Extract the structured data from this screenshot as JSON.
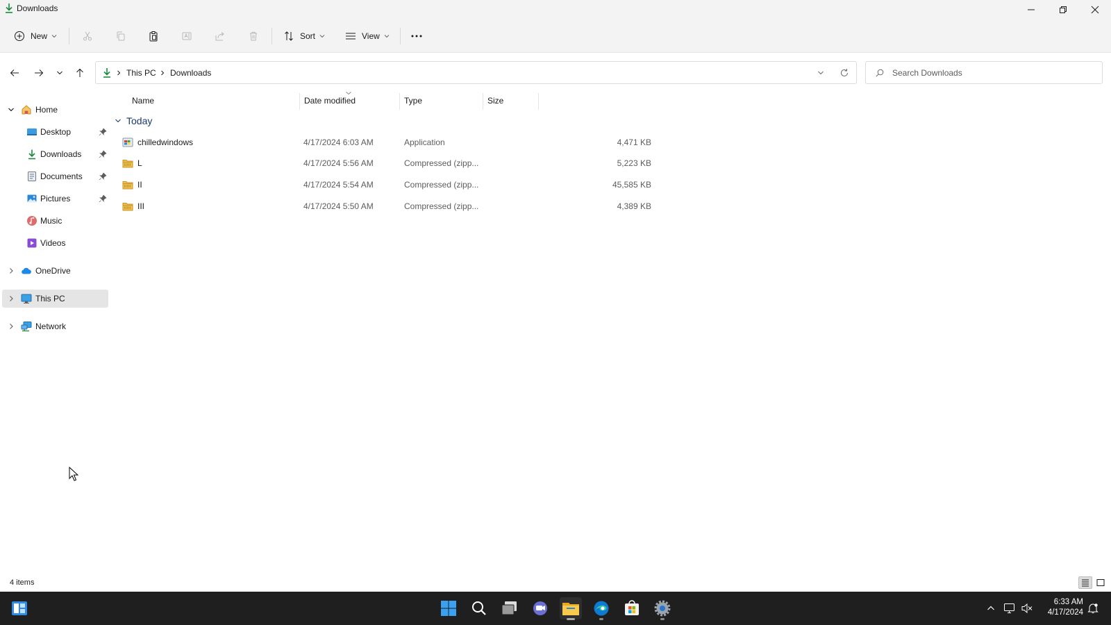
{
  "window": {
    "title": "Downloads"
  },
  "toolbar": {
    "new_label": "New",
    "sort_label": "Sort",
    "view_label": "View"
  },
  "address": {
    "crumbs": [
      "This PC",
      "Downloads"
    ]
  },
  "search": {
    "placeholder": "Search Downloads"
  },
  "sidebar": {
    "items": [
      {
        "label": "Home",
        "icon": "home-icon",
        "expanded": true
      },
      {
        "label": "Desktop",
        "icon": "desktop-icon",
        "pinned": true
      },
      {
        "label": "Downloads",
        "icon": "downloads-icon",
        "pinned": true
      },
      {
        "label": "Documents",
        "icon": "documents-icon",
        "pinned": true
      },
      {
        "label": "Pictures",
        "icon": "pictures-icon",
        "pinned": true
      },
      {
        "label": "Music",
        "icon": "music-icon"
      },
      {
        "label": "Videos",
        "icon": "videos-icon"
      },
      {
        "label": "OneDrive",
        "icon": "onedrive-icon"
      },
      {
        "label": "This PC",
        "icon": "this-pc-icon",
        "selected": true
      },
      {
        "label": "Network",
        "icon": "network-icon"
      }
    ]
  },
  "columns": {
    "name": "Name",
    "date": "Date modified",
    "type": "Type",
    "size": "Size"
  },
  "group": {
    "label": "Today"
  },
  "files": [
    {
      "name": "chilledwindows",
      "date": "4/17/2024 6:03 AM",
      "type": "Application",
      "size": "4,471 KB",
      "icon": "application-icon"
    },
    {
      "name": "L",
      "date": "4/17/2024 5:56 AM",
      "type": "Compressed (zipp...",
      "size": "5,223 KB",
      "icon": "zip-folder-icon"
    },
    {
      "name": "II",
      "date": "4/17/2024 5:54 AM",
      "type": "Compressed (zipp...",
      "size": "45,585 KB",
      "icon": "zip-folder-icon"
    },
    {
      "name": "III",
      "date": "4/17/2024 5:50 AM",
      "type": "Compressed (zipp...",
      "size": "4,389 KB",
      "icon": "zip-folder-icon"
    }
  ],
  "status": {
    "count": "4 items"
  },
  "clock": {
    "time": "6:33 AM",
    "date": "4/17/2024"
  },
  "colors": {
    "accent": "#0067c0",
    "selection": "#e5e5e5",
    "taskbar": "#1f1f1f",
    "folder": "#f0c04a"
  }
}
